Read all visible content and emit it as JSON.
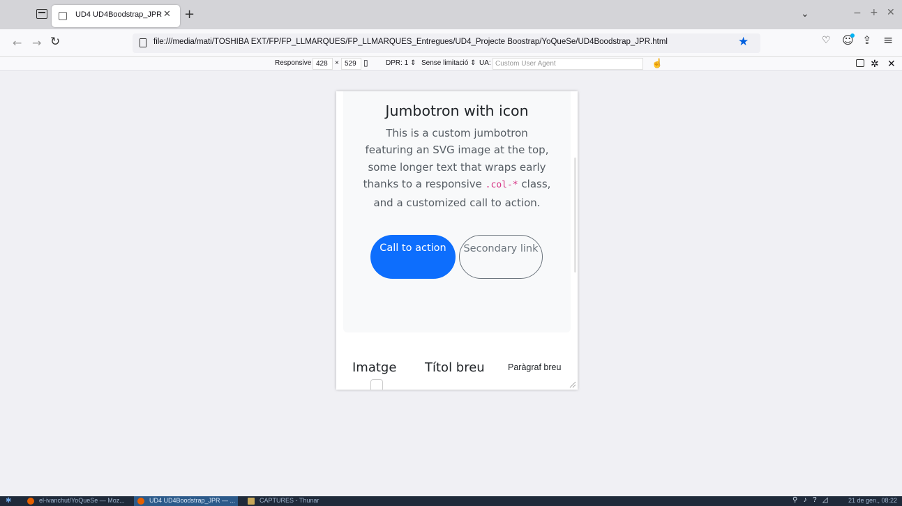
{
  "browser": {
    "tab_title": "UD4 UD4Boodstrap_JPR",
    "url": "file:///media/mati/TOSHIBA EXT/FP/FP_LLMARQUES/FP_LLMARQUES_Entregues/UD4_Projecte Boostrap/YoQueSe/UD4Boodstrap_JPR.html"
  },
  "rdm": {
    "preset": "Responsive",
    "width": "428",
    "times": "×",
    "height": "529",
    "dpr": "DPR: 1",
    "throttle": "Sense limitació",
    "ua_label": "UA:",
    "ua_placeholder": "Custom User Agent"
  },
  "page": {
    "jumbotron": {
      "title": "Jumbotron with icon",
      "text_before": "This is a custom jumbotron featuring an SVG image at the top, some longer text that wraps early thanks to a responsive ",
      "code": ".col-*",
      "text_after": " class, and a customized call to action.",
      "primary_button": "Call to action",
      "secondary_button": "Secondary link"
    },
    "features": {
      "image_label": "Imatge",
      "title_label": "Títol breu",
      "paragraph_label": "Paràgraf breu"
    }
  },
  "taskbar": {
    "tasks": [
      "el-ivanchut/YoQueSe — Moz...",
      "UD4 UD4Boodstrap_JPR — ...",
      "CAPTURES - Thunar"
    ],
    "clock": "21 de gen., 08:22"
  },
  "colors": {
    "primary": "#0d6efd",
    "secondary": "#6c757d",
    "code": "#d63384",
    "bookmark_star": "#0060df"
  },
  "icons": [
    "tab-list-icon",
    "close-icon",
    "plus-icon",
    "chevron-down-icon",
    "back-icon",
    "forward-icon",
    "reload-icon",
    "page-icon",
    "star-icon",
    "pocket-icon",
    "account-icon",
    "extensions-icon",
    "menu-icon",
    "rotate-icon",
    "touch-icon",
    "screenshot-icon",
    "settings-icon",
    "resize-handle-icon"
  ]
}
